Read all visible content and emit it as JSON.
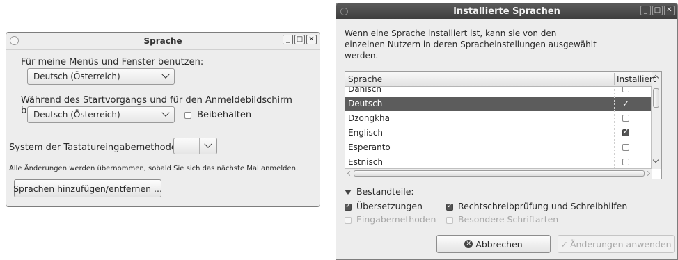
{
  "sprache_window": {
    "title": "Sprache",
    "menus_label": "Für meine Menüs und Fenster benutzen:",
    "menus_value": "Deutsch (Österreich)",
    "startup_label": "Während des Startvorgangs und für den Anmeldebildschirm benutzen:",
    "startup_value": "Deutsch (Österreich)",
    "keep_label": "Beibehalten",
    "keep_checked": false,
    "input_method_label": "System der Tastatureingabemethode:",
    "input_method_value": "",
    "notice": "Alle Änderungen werden übernommen, sobald Sie sich das nächste Mal anmelden.",
    "add_remove_button": "Sprachen hinzufügen/entfernen ..."
  },
  "installed_window": {
    "title": "Installierte Sprachen",
    "description_lines": [
      "Wenn eine Sprache installiert ist, kann sie von den",
      "einzelnen Nutzern in deren Spracheinstellungen ausgewählt",
      "werden."
    ],
    "columns": {
      "language": "Sprache",
      "installed": "Installiert"
    },
    "rows": [
      {
        "name": "Dänisch",
        "installed": false,
        "selected": false
      },
      {
        "name": "Deutsch",
        "installed": true,
        "selected": true
      },
      {
        "name": "Dzongkha",
        "installed": false,
        "selected": false
      },
      {
        "name": "Englisch",
        "installed": true,
        "selected": false
      },
      {
        "name": "Esperanto",
        "installed": false,
        "selected": false
      },
      {
        "name": "Estnisch",
        "installed": false,
        "selected": false
      }
    ],
    "components_label": "Bestandteile:",
    "components": [
      {
        "label": "Übersetzungen",
        "checked": true,
        "enabled": true
      },
      {
        "label": "Rechtschreibprüfung und Schreibhilfen",
        "checked": true,
        "enabled": true
      },
      {
        "label": "Eingabemethoden",
        "checked": false,
        "enabled": false
      },
      {
        "label": "Besondere Schriftarten",
        "checked": false,
        "enabled": false
      }
    ],
    "cancel_button": "Abbrechen",
    "apply_button": "Änderungen anwenden"
  },
  "window_buttons": {
    "minimize": "_",
    "maximize": "□",
    "close": "✕"
  }
}
